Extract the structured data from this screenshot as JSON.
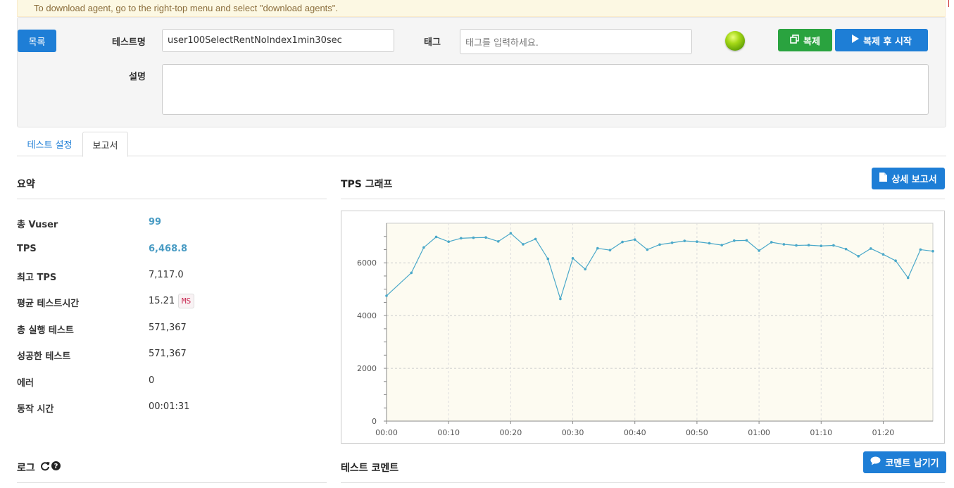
{
  "banner": {
    "text": "To download agent, go to the right-top menu and select \"download agents\"."
  },
  "top": {
    "list_button": "목록",
    "test_name_label": "테스트명",
    "test_name_value": "user100SelectRentNoIndex1min30sec",
    "tag_label": "태그",
    "tag_placeholder": "태그를 입력하세요.",
    "copy_button": "복제",
    "copy_start_button": "복제 후 시작",
    "description_label": "설명",
    "description_value": ""
  },
  "tabs": [
    {
      "label": "테스트 설정",
      "active": false
    },
    {
      "label": "보고서",
      "active": true
    }
  ],
  "summary": {
    "title": "요약",
    "rows": [
      {
        "label": "총 Vuser",
        "value": "99"
      },
      {
        "label": "TPS",
        "value": "6,468.8"
      },
      {
        "label": "최고 TPS",
        "value": "7,117.0"
      },
      {
        "label": "평균 테스트시간",
        "value": "15.21",
        "unit": "MS"
      },
      {
        "label": "총 실행 테스트",
        "value": "571,367"
      },
      {
        "label": "성공한 테스트",
        "value": "571,367"
      },
      {
        "label": "에러",
        "value": "0"
      },
      {
        "label": "동작 시간",
        "value": "00:01:31"
      }
    ]
  },
  "tps": {
    "title": "TPS 그래프",
    "detail_button": "상세 보고서"
  },
  "log": {
    "title": "로그"
  },
  "comment": {
    "title": "테스트 코멘트",
    "button": "코멘트 남기기"
  },
  "icons": {
    "copy": "copy-icon",
    "play": "play-icon",
    "document": "document-icon",
    "refresh": "refresh-icon",
    "help": "question-circle-icon",
    "comment": "comment-icon"
  },
  "colors": {
    "primary": "#1e7ed6",
    "success": "#2aa33f",
    "line": "#4aa8c9",
    "plot_bg": "#fdfbf1"
  },
  "chart_data": {
    "type": "line",
    "title": "",
    "xlabel": "",
    "ylabel": "",
    "x_ticks": [
      "00:00",
      "00:10",
      "00:20",
      "00:30",
      "00:40",
      "00:50",
      "01:00",
      "01:10",
      "01:20"
    ],
    "y_ticks": [
      0,
      2000,
      4000,
      6000
    ],
    "xlim": [
      0,
      88
    ],
    "ylim": [
      0,
      7500
    ],
    "grid": true,
    "series": [
      {
        "values": [
          [
            0,
            4750
          ],
          [
            4,
            5620
          ],
          [
            6,
            6580
          ],
          [
            8,
            6980
          ],
          [
            10,
            6800
          ],
          [
            12,
            6930
          ],
          [
            14,
            6950
          ],
          [
            16,
            6960
          ],
          [
            18,
            6810
          ],
          [
            20,
            7117
          ],
          [
            22,
            6700
          ],
          [
            24,
            6900
          ],
          [
            26,
            6150
          ],
          [
            28,
            4630
          ],
          [
            30,
            6170
          ],
          [
            32,
            5760
          ],
          [
            34,
            6550
          ],
          [
            36,
            6480
          ],
          [
            38,
            6790
          ],
          [
            40,
            6880
          ],
          [
            42,
            6500
          ],
          [
            44,
            6690
          ],
          [
            46,
            6760
          ],
          [
            48,
            6830
          ],
          [
            50,
            6800
          ],
          [
            52,
            6740
          ],
          [
            54,
            6670
          ],
          [
            56,
            6840
          ],
          [
            58,
            6850
          ],
          [
            60,
            6460
          ],
          [
            62,
            6780
          ],
          [
            64,
            6700
          ],
          [
            66,
            6660
          ],
          [
            68,
            6670
          ],
          [
            70,
            6640
          ],
          [
            72,
            6660
          ],
          [
            74,
            6520
          ],
          [
            76,
            6250
          ],
          [
            78,
            6540
          ],
          [
            80,
            6320
          ],
          [
            82,
            6080
          ],
          [
            84,
            5430
          ],
          [
            86,
            6500
          ],
          [
            88,
            6440
          ]
        ]
      }
    ]
  }
}
